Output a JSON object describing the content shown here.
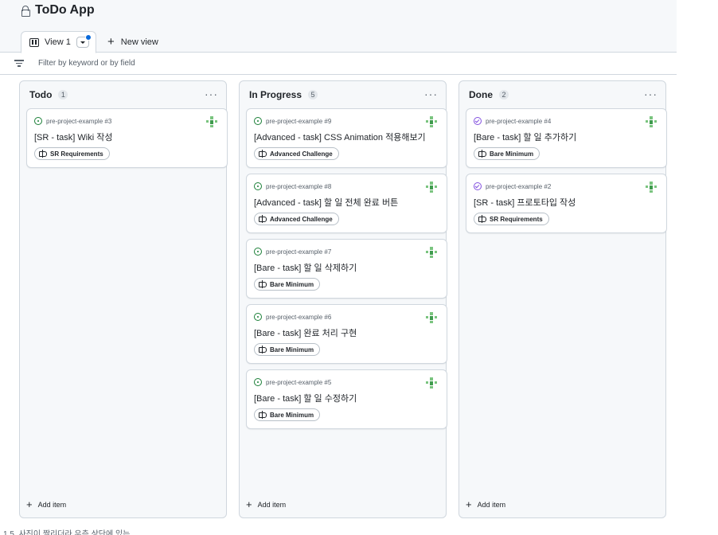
{
  "header": {
    "title": "ToDo App",
    "lock_icon": "lock-icon"
  },
  "tabs": {
    "view_label": "View 1",
    "new_view_label": "New view"
  },
  "filter": {
    "placeholder": "Filter by keyword or by field",
    "icon": "filter-lines-icon"
  },
  "colors": {
    "open": "#1a7f37",
    "done": "#8250df",
    "accent": "#0969da"
  },
  "columns": [
    {
      "title": "Todo",
      "count": "1",
      "add_label": "Add item",
      "cards": [
        {
          "ref": "pre-project-example #3",
          "title": "[SR - task] Wiki 작성",
          "label": "SR Requirements",
          "status": "open"
        }
      ]
    },
    {
      "title": "In Progress",
      "count": "5",
      "add_label": "Add item",
      "cards": [
        {
          "ref": "pre-project-example #9",
          "title": "[Advanced - task] CSS Animation 적용해보기",
          "label": "Advanced Challenge",
          "status": "open"
        },
        {
          "ref": "pre-project-example #8",
          "title": "[Advanced - task] 할 일 전체 완료 버튼",
          "label": "Advanced Challenge",
          "status": "open"
        },
        {
          "ref": "pre-project-example #7",
          "title": "[Bare - task] 할 일 삭제하기",
          "label": "Bare Minimum",
          "status": "open"
        },
        {
          "ref": "pre-project-example #6",
          "title": "[Bare - task] 완료 처리 구현",
          "label": "Bare Minimum",
          "status": "open"
        },
        {
          "ref": "pre-project-example #5",
          "title": "[Bare - task] 할 일 수정하기",
          "label": "Bare Minimum",
          "status": "open"
        }
      ]
    },
    {
      "title": "Done",
      "count": "2",
      "add_label": "Add item",
      "cards": [
        {
          "ref": "pre-project-example #4",
          "title": "[Bare - task] 할 일 추가하기",
          "label": "Bare Minimum",
          "status": "done"
        },
        {
          "ref": "pre-project-example #2",
          "title": "[SR - task] 프로토타입 작성",
          "label": "SR Requirements",
          "status": "done"
        }
      ]
    }
  ],
  "footnote": "1 5. 사진이 짤리더라 우측 상단에 있는"
}
